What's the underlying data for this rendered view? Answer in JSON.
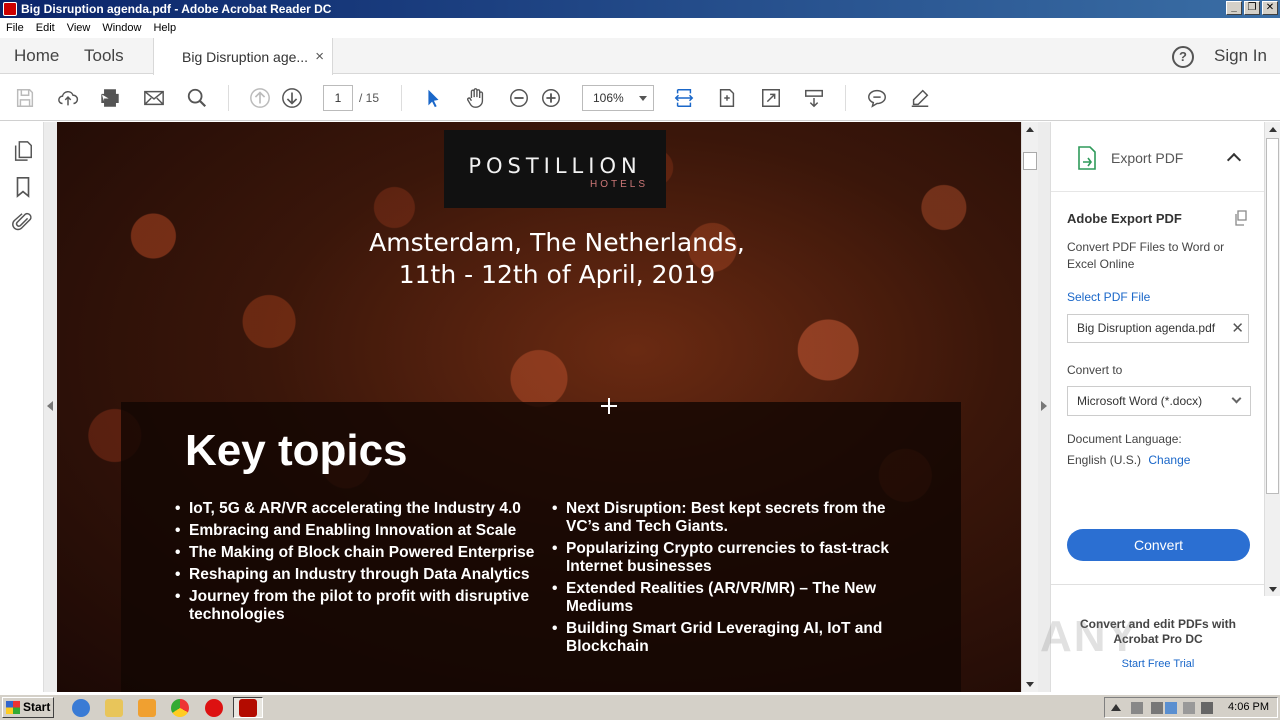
{
  "window": {
    "title": "Big Disruption agenda.pdf - Adobe Acrobat Reader DC"
  },
  "menu": [
    "File",
    "Edit",
    "View",
    "Window",
    "Help"
  ],
  "tabs": {
    "home": "Home",
    "tools": "Tools",
    "doc_tab": "Big Disruption age...",
    "close": "×",
    "help": "?",
    "sign_in": "Sign In"
  },
  "toolbar": {
    "page_current": "1",
    "page_total": "/ 15",
    "zoom": "106%"
  },
  "document": {
    "logo_line1": "POSTILLION",
    "logo_line2": "HOTELS",
    "location_line1": "Amsterdam, The Netherlands,",
    "location_line2": "11th - 12th of April, 2019",
    "heading": "Key topics",
    "topics_left": [
      "IoT, 5G & AR/VR accelerating the Industry 4.0",
      "Embracing and Enabling Innovation at Scale",
      "The Making of Block chain Powered Enterprise",
      "Reshaping an Industry through Data Analytics",
      "Journey from the pilot to profit with disruptive technologies"
    ],
    "topics_right": [
      "Next Disruption: Best kept secrets from the VC’s and Tech Giants.",
      "Popularizing Crypto currencies to fast-track Internet businesses",
      "Extended Realities (AR/VR/MR) – The New Mediums",
      "Building Smart Grid Leveraging AI, IoT and Blockchain"
    ]
  },
  "right_pane": {
    "header": "Export PDF",
    "title": "Adobe Export PDF",
    "description": "Convert PDF Files to Word or Excel Online",
    "select_file_link": "Select PDF File",
    "file_name": "Big Disruption agenda.pdf",
    "file_clear": "✕",
    "convert_to_label": "Convert to",
    "convert_to_value": "Microsoft Word (*.docx)",
    "doc_lang_label": "Document Language:",
    "doc_lang_value": "English (U.S.)",
    "change_link": "Change",
    "convert_button": "Convert",
    "promo": "Convert and edit PDFs with Acrobat Pro DC",
    "trial_link": "Start Free Trial",
    "watermark": "ANY"
  },
  "taskbar": {
    "start": "Start",
    "clock": "4:06 PM"
  },
  "colors": {
    "accent": "#2b6fd2",
    "link": "#1a67c9",
    "titlebar": "#0a246a"
  }
}
